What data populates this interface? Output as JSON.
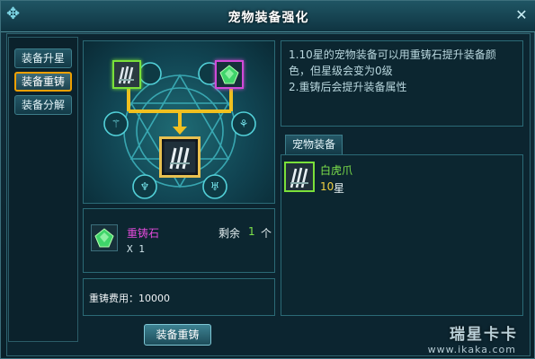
{
  "window": {
    "title": "宠物装备强化",
    "close_icon": "close-icon"
  },
  "tabs": [
    {
      "label": "装备升星",
      "active": false
    },
    {
      "label": "装备重铸",
      "active": true
    },
    {
      "label": "装备分解",
      "active": false
    }
  ],
  "description": {
    "line1": "1.10星的宠物装备可以用重铸石提升装备颜",
    "line2": "色，但星级会变为0级",
    "line3": "2.重铸后会提升装备属性"
  },
  "equipment_tab": {
    "label": "宠物装备"
  },
  "equipment_list": [
    {
      "name": "白虎爪",
      "stars_value": "10",
      "stars_unit": "星",
      "name_color": "#7ee34a",
      "icon": "claw-icon"
    }
  ],
  "stone": {
    "name": "重铸石",
    "quantity_text": "X 1",
    "remaining_label": "剩余",
    "remaining_value": "1",
    "remaining_unit": "个",
    "name_color": "#e04ad8",
    "icon": "gem-icon"
  },
  "cost": {
    "label": "重铸费用：10000"
  },
  "actions": {
    "recast_button": "装备重铸"
  },
  "watermark": {
    "text": "瑞星卡卡",
    "url": "www.ikaka.com"
  },
  "colors": {
    "accent_gold": "#f0a000",
    "green": "#7ae03a",
    "purple": "#d04ad8"
  }
}
